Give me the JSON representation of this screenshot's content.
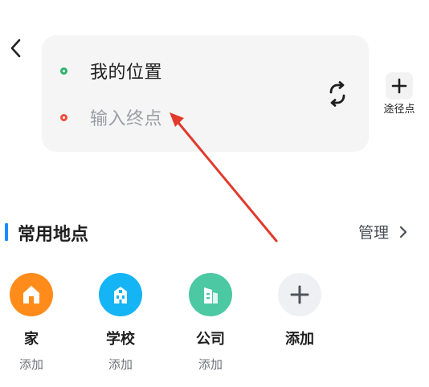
{
  "route": {
    "origin_text": "我的位置",
    "destination_placeholder": "输入终点",
    "origin_color": "#2eb36b",
    "destination_color": "#f04b3b"
  },
  "waypoint": {
    "label": "途径点"
  },
  "section": {
    "title": "常用地点",
    "manage_label": "管理",
    "accent_color": "#1a8cff"
  },
  "places": [
    {
      "name": "家",
      "sub": "添加",
      "icon": "house-icon",
      "color": "#ff8c1a"
    },
    {
      "name": "学校",
      "sub": "添加",
      "icon": "school-building-icon",
      "color": "#14b4f5"
    },
    {
      "name": "公司",
      "sub": "添加",
      "icon": "office-building-icon",
      "color": "#4cc8a3"
    },
    {
      "name": "添加",
      "sub": "",
      "icon": "plus-icon",
      "color": "#eef0f3"
    }
  ],
  "icons": {
    "back": "chevron-left-icon",
    "swap": "swap-icon",
    "manage": "chevron-right-icon"
  }
}
